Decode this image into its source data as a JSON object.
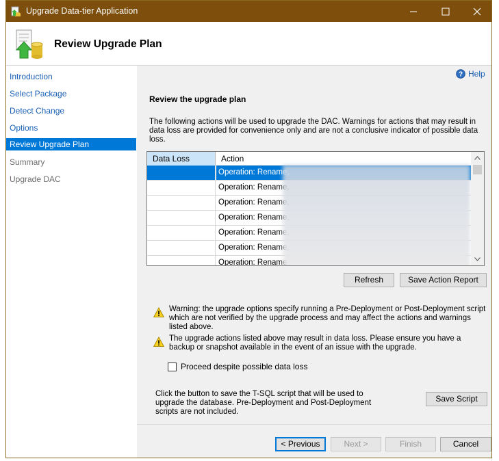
{
  "window": {
    "title": "Upgrade Data-tier Application"
  },
  "header": {
    "title": "Review Upgrade Plan"
  },
  "sidebar": {
    "items": [
      {
        "label": "Introduction",
        "state": "link"
      },
      {
        "label": "Select Package",
        "state": "link"
      },
      {
        "label": "Detect Change",
        "state": "link"
      },
      {
        "label": "Options",
        "state": "link"
      },
      {
        "label": "Review Upgrade Plan",
        "state": "active"
      },
      {
        "label": "Summary",
        "state": "disabled"
      },
      {
        "label": "Upgrade DAC",
        "state": "disabled"
      }
    ]
  },
  "help": {
    "label": "Help"
  },
  "main": {
    "section_title": "Review the upgrade plan",
    "description": "The following actions will be used to upgrade the DAC.  Warnings for actions that may result in data loss are provided for convenience only and are not a conclusive indicator of possible data loss.",
    "grid": {
      "columns": [
        "Data Loss",
        "Action"
      ],
      "rows": [
        {
          "data_loss": "",
          "action": "Operation: Rename,"
        },
        {
          "data_loss": "",
          "action": "Operation: Rename,"
        },
        {
          "data_loss": "",
          "action": "Operation: Rename,"
        },
        {
          "data_loss": "",
          "action": "Operation: Rename,"
        },
        {
          "data_loss": "",
          "action": "Operation: Rename,"
        },
        {
          "data_loss": "",
          "action": "Operation: Rename,"
        },
        {
          "data_loss": "",
          "action": "Operation: Rename"
        }
      ]
    },
    "refresh_label": "Refresh",
    "save_report_label": "Save Action Report",
    "warning1": "Warning: the upgrade options specify running a Pre-Deployment or Post-Deployment script which are not verified by the upgrade process and may affect the actions and warnings listed above.",
    "warning2": "The upgrade actions listed above may result in data loss.  Please ensure you have a backup or snapshot available in the event of an issue with the upgrade.",
    "proceed_label": "Proceed despite possible data loss",
    "proceed_checked": false,
    "save_script_desc": "Click the button to save the T-SQL script that will be used to upgrade the database. Pre-Deployment and Post-Deployment scripts are not included.",
    "save_script_label": "Save Script"
  },
  "footer": {
    "previous_label": "< Previous",
    "next_label": "Next >",
    "finish_label": "Finish",
    "cancel_label": "Cancel"
  },
  "colors": {
    "titlebar": "#7d4e0c",
    "selection": "#0078d7",
    "link": "#1a5fb4",
    "panel": "#f0f0f0"
  }
}
